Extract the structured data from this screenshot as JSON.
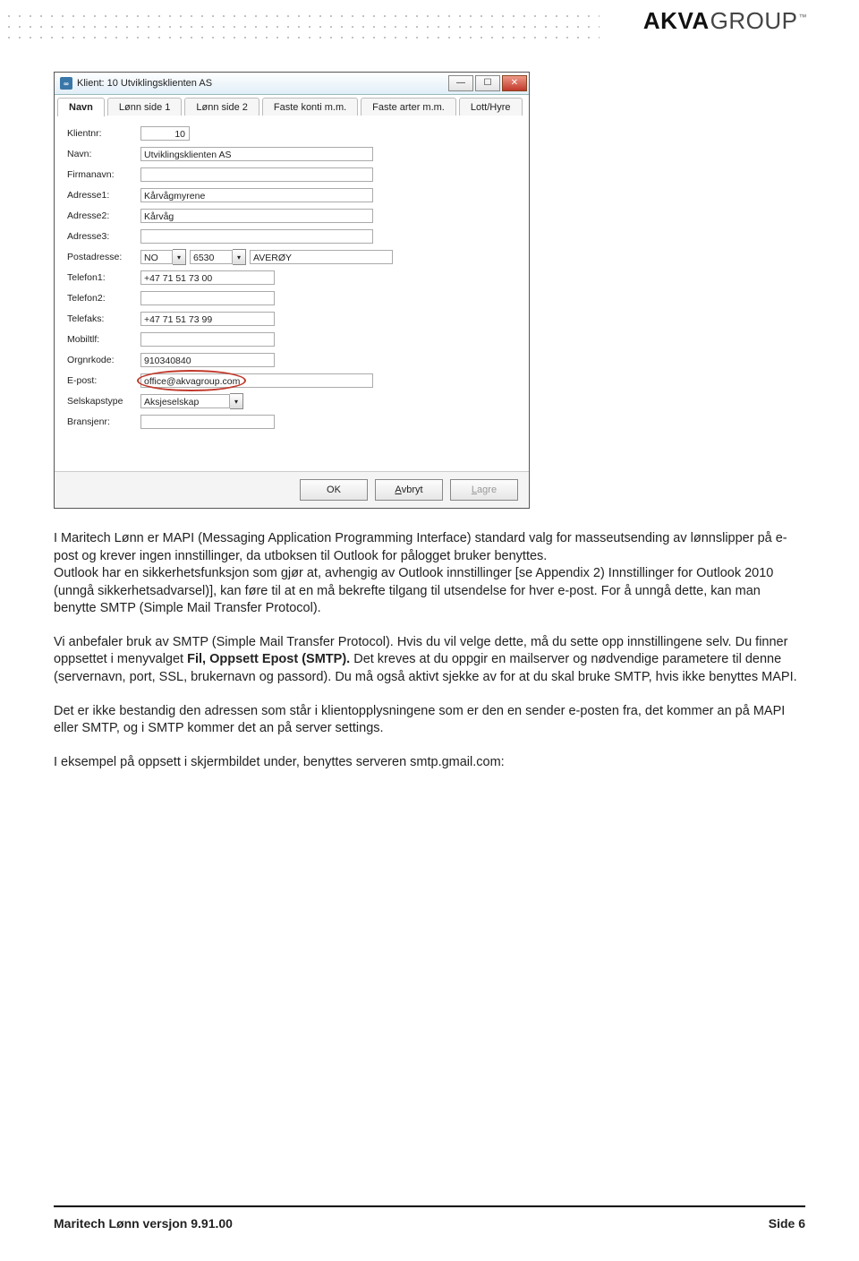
{
  "brand": {
    "bold": "AKVA",
    "light": "GROUP",
    "tm": "™"
  },
  "window": {
    "title": "Klient: 10  Utviklingsklienten AS",
    "icon_text": "∞",
    "tabs": [
      "Navn",
      "Lønn side 1",
      "Lønn side 2",
      "Faste konti m.m.",
      "Faste arter m.m.",
      "Lott/Hyre"
    ],
    "fields": {
      "klientnr": {
        "label": "Klientnr:",
        "value": "10"
      },
      "navn": {
        "label": "Navn:",
        "value": "Utviklingsklienten AS"
      },
      "firmanavn": {
        "label": "Firmanavn:",
        "value": ""
      },
      "adresse1": {
        "label": "Adresse1:",
        "value": "Kårvågmyrene"
      },
      "adresse2": {
        "label": "Adresse2:",
        "value": "Kårvåg"
      },
      "adresse3": {
        "label": "Adresse3:",
        "value": ""
      },
      "postadresse": {
        "label": "Postadresse:",
        "country": "NO",
        "code": "6530",
        "place": "AVERØY"
      },
      "telefon1": {
        "label": "Telefon1:",
        "value": "+47 71 51 73 00"
      },
      "telefon2": {
        "label": "Telefon2:",
        "value": ""
      },
      "telefaks": {
        "label": "Telefaks:",
        "value": "+47 71 51 73 99"
      },
      "mobiltlf": {
        "label": "Mobiltlf:",
        "value": ""
      },
      "orgnrkode": {
        "label": "Orgnrkode:",
        "value": "910340840"
      },
      "epost": {
        "label": "E-post:",
        "value": "office@akvagroup.com"
      },
      "selskapstype": {
        "label": "Selskapstype",
        "value": "Aksjeselskap"
      },
      "bransjenr": {
        "label": "Bransjenr:",
        "value": ""
      }
    },
    "buttons": {
      "ok": "OK",
      "avbryt": "Avbryt",
      "avbryt_acc": "A",
      "lagre": "Lagre",
      "lagre_acc": "L"
    }
  },
  "paragraphs": {
    "p1": "I Maritech Lønn er MAPI (Messaging Application Programming Interface) standard valg for masseutsending av lønnslipper på e-post og krever ingen innstillinger, da utboksen til Outlook for pålogget bruker benyttes.",
    "p1b": "Outlook har en sikkerhetsfunksjon som gjør at, avhengig av Outlook innstillinger [se Appendix 2) Innstillinger for Outlook 2010 (unngå sikkerhetsadvarsel)], kan føre til at en må bekrefte tilgang til utsendelse for hver e-post. For å unngå dette, kan man benytte SMTP (Simple Mail Transfer Protocol).",
    "p2_a": "Vi anbefaler bruk av SMTP (Simple Mail Transfer Protocol). Hvis du vil velge dette, må du sette opp innstillingene selv. Du finner oppsettet i menyvalget ",
    "p2_bold": "Fil, Oppsett Epost (SMTP).",
    "p2_b": " Det kreves at du oppgir en mailserver og nødvendige parametere til denne (servernavn, port, SSL, brukernavn og passord). Du må også aktivt sjekke av for at du skal bruke SMTP, hvis ikke benyttes MAPI.",
    "p3": "Det er ikke bestandig den adressen som står i klientopplysningene som er den en sender e-posten fra, det kommer an på MAPI eller SMTP, og i SMTP kommer det an på server settings.",
    "p4": "I eksempel på oppsett i skjermbildet under, benyttes serveren smtp.gmail.com:"
  },
  "footer": {
    "left": "Maritech Lønn versjon 9.91.00",
    "right": "Side 6"
  }
}
